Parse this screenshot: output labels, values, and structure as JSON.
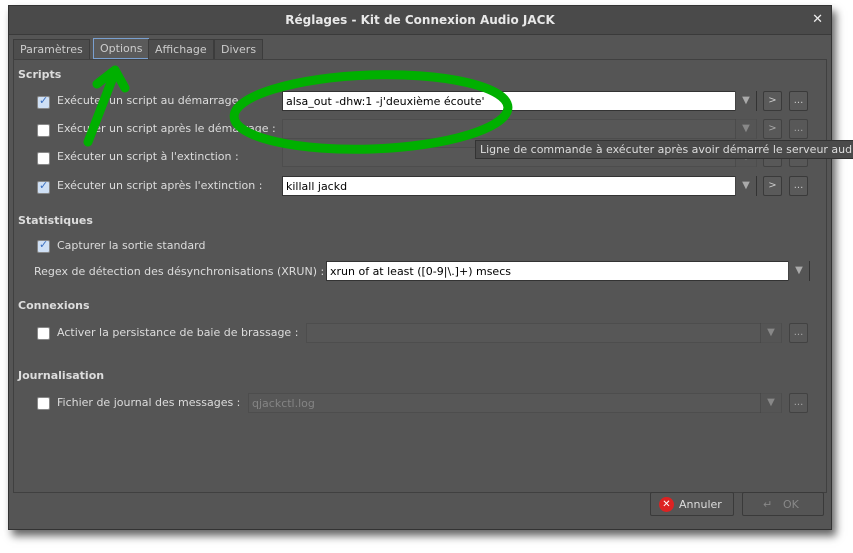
{
  "window": {
    "title": "Réglages - Kit de Connexion Audio JACK",
    "close": "✕"
  },
  "tabs": [
    "Paramètres",
    "Options",
    "Affichage",
    "Divers"
  ],
  "scripts": {
    "heading": "Scripts",
    "rows": [
      {
        "label": "Exécuter un script au démarrage :",
        "checked": true,
        "value": "alsa_out -dhw:1 -j'deuxième écoute'"
      },
      {
        "label": "Exécuter un script après le démarrage :",
        "checked": false,
        "value": ""
      },
      {
        "label": "Exécuter un script à l'extinction :",
        "checked": false,
        "value": ""
      },
      {
        "label": "Exécuter un script après l'extinction :",
        "checked": true,
        "value": "killall jackd"
      }
    ]
  },
  "statistiques": {
    "heading": "Statistiques",
    "capture_label": "Capturer la sortie standard",
    "regex_label": "Regex de détection des désynchronisations (XRUN) :",
    "regex_value": "xrun of at least ([0-9|\\.]+) msecs"
  },
  "connexions": {
    "heading": "Connexions",
    "label": "Activer la persistance de baie de brassage :",
    "value": ""
  },
  "journal": {
    "heading": "Journalisation",
    "label": "Fichier de journal des messages :",
    "value": "qjackctl.log"
  },
  "tooltip": "Ligne de commande à exécuter après avoir démarré le serveur audio",
  "buttons": {
    "cancel": "Annuler",
    "ok": "OK",
    "symbol": ">",
    "browse": "..."
  },
  "annotation_color": "#00b000"
}
